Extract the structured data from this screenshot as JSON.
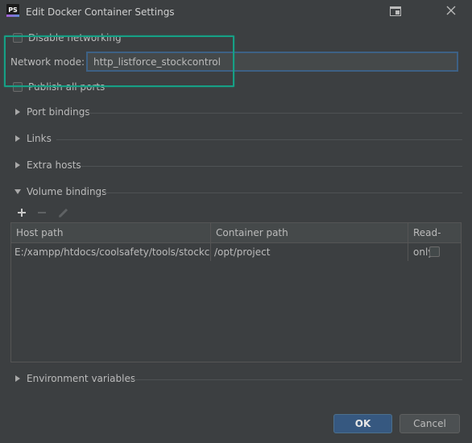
{
  "window": {
    "title": "Edit Docker Container Settings",
    "app_icon_text": "PS",
    "app_icon_name": "phpstorm-icon"
  },
  "options": {
    "disable_networking": {
      "label": "Disable networking",
      "checked": false
    },
    "network_mode": {
      "label": "Network mode:",
      "value": "http_listforce_stockcontrol"
    },
    "publish_all_ports": {
      "label": "Publish all ports",
      "checked": false
    }
  },
  "sections": {
    "port_bindings": {
      "label": "Port bindings",
      "expanded": false
    },
    "links": {
      "label": "Links",
      "expanded": false
    },
    "extra_hosts": {
      "label": "Extra hosts",
      "expanded": false
    },
    "volume_bindings": {
      "label": "Volume bindings",
      "expanded": true
    },
    "environment_variables": {
      "label": "Environment variables",
      "expanded": false
    }
  },
  "volume_toolbar": {
    "add_icon": "plus-icon",
    "remove_icon": "minus-icon",
    "edit_icon": "pencil-icon"
  },
  "volume_table": {
    "columns": [
      "Host path",
      "Container path",
      "Read-only"
    ],
    "rows": [
      {
        "host_path": "E:/xampp/htdocs/coolsafety/tools/stockco...",
        "container_path": "/opt/project",
        "read_only": false
      }
    ]
  },
  "buttons": {
    "ok": "OK",
    "cancel": "Cancel"
  },
  "colors": {
    "background": "#3c3f41",
    "highlight": "#16a085",
    "primary_button": "#365880",
    "input_focus_border": "#3d6185"
  }
}
